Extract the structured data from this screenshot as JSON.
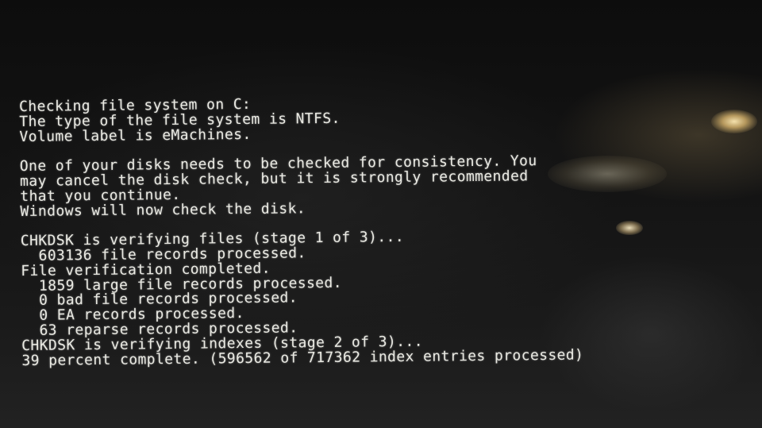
{
  "console": {
    "lines": [
      "Checking file system on C:",
      "The type of the file system is NTFS.",
      "Volume label is eMachines.",
      "",
      "One of your disks needs to be checked for consistency. You",
      "may cancel the disk check, but it is strongly recommended",
      "that you continue.",
      "Windows will now check the disk.",
      "",
      "CHKDSK is verifying files (stage 1 of 3)...",
      "  603136 file records processed.",
      "File verification completed.",
      "  1859 large file records processed.",
      "  0 bad file records processed.",
      "  0 EA records processed.",
      "  63 reparse records processed.",
      "CHKDSK is verifying indexes (stage 2 of 3)...",
      "39 percent complete. (596562 of 717362 index entries processed)"
    ]
  },
  "colors": {
    "text": "#e9e9e2",
    "background": "#050505"
  }
}
